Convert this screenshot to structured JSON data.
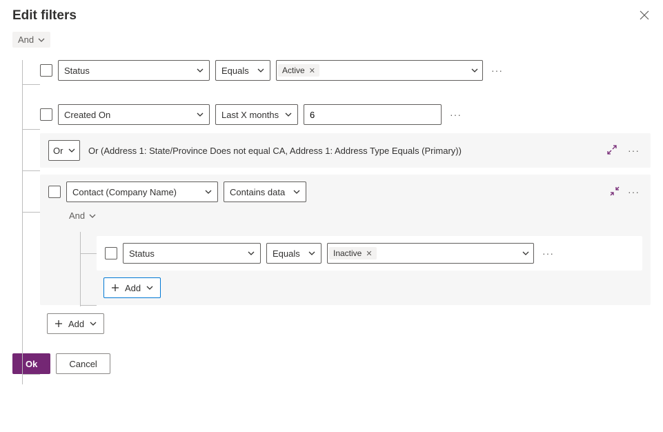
{
  "header": {
    "title": "Edit filters"
  },
  "root_group": "And",
  "filters": [
    {
      "field": "Status",
      "operator": "Equals",
      "value_tag": "Active"
    },
    {
      "field": "Created On",
      "operator": "Last X months",
      "value_text": "6"
    }
  ],
  "or_block": {
    "group": "Or",
    "summary": "Or (Address 1: State/Province Does not equal CA, Address 1: Address Type Equals (Primary))"
  },
  "related": {
    "field": "Contact (Company Name)",
    "operator": "Contains data",
    "inner_group": "And",
    "filter": {
      "field": "Status",
      "operator": "Equals",
      "value_tag": "Inactive"
    },
    "add_label": "Add"
  },
  "add_row_label": "Add",
  "buttons": {
    "ok": "Ok",
    "cancel": "Cancel"
  }
}
